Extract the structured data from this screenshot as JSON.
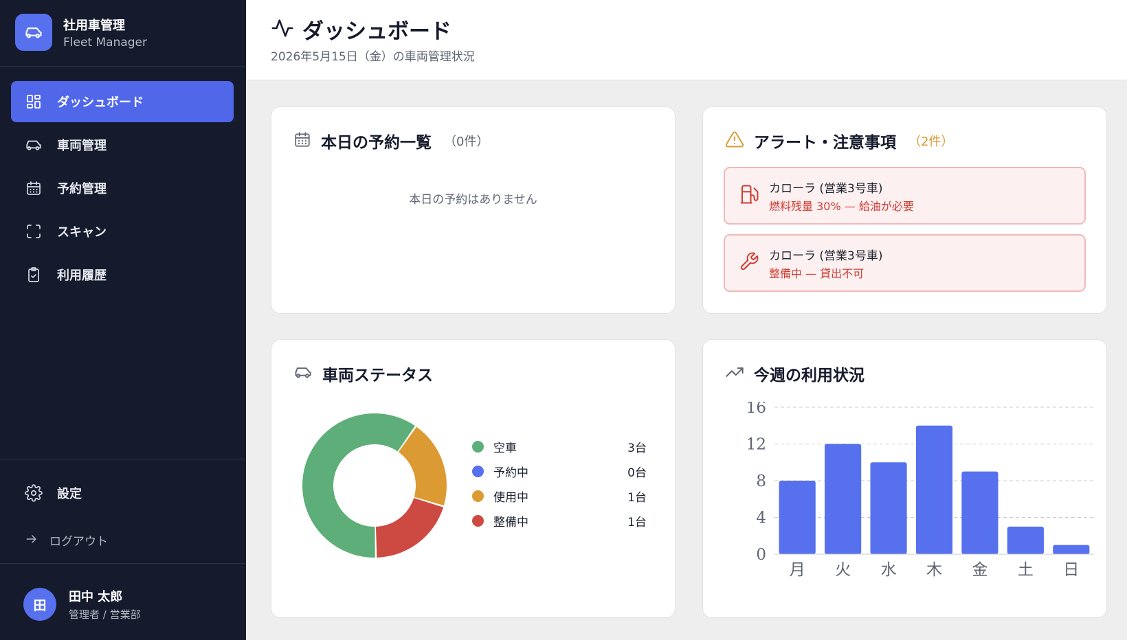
{
  "brand": {
    "title": "社用車管理",
    "subtitle": "Fleet Manager"
  },
  "nav": [
    {
      "label": "ダッシュボード",
      "icon": "grid-icon",
      "active": true
    },
    {
      "label": "車両管理",
      "icon": "car-icon"
    },
    {
      "label": "予約管理",
      "icon": "calendar-icon"
    },
    {
      "label": "スキャン",
      "icon": "scan-icon"
    },
    {
      "label": "利用履歴",
      "icon": "clipboard-check-icon"
    }
  ],
  "settings": {
    "label": "設定"
  },
  "logout": {
    "label": "ログアウト"
  },
  "user": {
    "initial": "田",
    "name": "田中 太郎",
    "role": "管理者 / 営業部"
  },
  "header": {
    "title": "ダッシュボード",
    "subtitle": "2026年5月15日（金）の車両管理状況"
  },
  "reservations": {
    "title": "本日の予約一覧",
    "count": "（0件）",
    "empty": "本日の予約はありません"
  },
  "alerts": {
    "title": "アラート・注意事項",
    "count": "（2件）",
    "items": [
      {
        "icon": "fuel-icon",
        "name": "カローラ (営業3号車)",
        "detail": "燃料残量 30% — 給油が必要"
      },
      {
        "icon": "wrench-icon",
        "name": "カローラ (営業3号車)",
        "detail": "整備中 — 貸出不可"
      }
    ]
  },
  "vehicle_status": {
    "title": "車両ステータス",
    "items": [
      {
        "label": "空車",
        "value": "3台",
        "count": 3,
        "color": "#5dae78"
      },
      {
        "label": "予約中",
        "value": "0台",
        "count": 0,
        "color": "#5670ee"
      },
      {
        "label": "使用中",
        "value": "1台",
        "count": 1,
        "color": "#dc9a32"
      },
      {
        "label": "整備中",
        "value": "1台",
        "count": 1,
        "color": "#cc4a42"
      }
    ]
  },
  "weekly": {
    "title": "今週の利用状況"
  },
  "colors": {
    "accent": "#5670ee",
    "sidebar": "#151a2c",
    "alert_text": "#d03b32",
    "warning": "#dc9a32"
  },
  "chart_data": {
    "type": "bar",
    "categories": [
      "月",
      "火",
      "水",
      "木",
      "金",
      "土",
      "日"
    ],
    "values": [
      8,
      12,
      10,
      14,
      9,
      3,
      1
    ],
    "yticks": [
      0,
      4,
      8,
      12,
      16
    ],
    "ylim": [
      0,
      16
    ],
    "grid": true,
    "color": "#5670ee"
  }
}
